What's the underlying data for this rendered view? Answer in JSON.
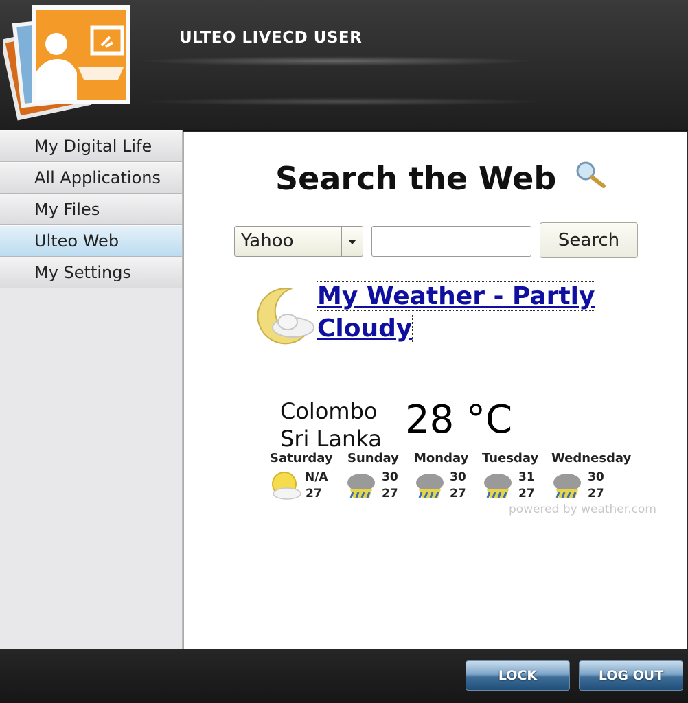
{
  "header": {
    "title": "ULTEO LIVECD USER"
  },
  "sidebar": {
    "items": [
      {
        "label": "My Digital Life",
        "active": false
      },
      {
        "label": "All Applications",
        "active": false
      },
      {
        "label": "My Files",
        "active": false
      },
      {
        "label": "Ulteo Web",
        "active": true
      },
      {
        "label": "My Settings",
        "active": false
      }
    ]
  },
  "search": {
    "title": "Search the Web",
    "engine": "Yahoo",
    "query": "",
    "button_label": "Search"
  },
  "weather": {
    "link_line1": "My Weather - Partly",
    "link_line2": "Cloudy",
    "city": "Colombo",
    "country": "Sri Lanka",
    "temperature": "28 °C",
    "forecast": [
      {
        "day": "Saturday",
        "high": "N/A",
        "low": "27",
        "icon": "partly-sunny-icon"
      },
      {
        "day": "Sunday",
        "high": "30",
        "low": "27",
        "icon": "thunderstorm-icon"
      },
      {
        "day": "Monday",
        "high": "30",
        "low": "27",
        "icon": "thunderstorm-icon"
      },
      {
        "day": "Tuesday",
        "high": "31",
        "low": "27",
        "icon": "thunderstorm-icon"
      },
      {
        "day": "Wednesday",
        "high": "30",
        "low": "27",
        "icon": "thunderstorm-icon"
      }
    ],
    "powered_by": "powered by weather.com"
  },
  "footer": {
    "lock_label": "LOCK",
    "logout_label": "LOG OUT"
  },
  "colors": {
    "accent": "#bcdcf0",
    "link": "#1010a0"
  }
}
